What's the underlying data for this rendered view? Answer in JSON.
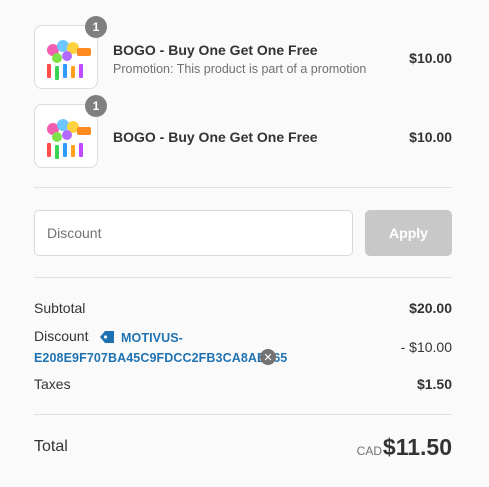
{
  "line_items": [
    {
      "quantity": "1",
      "title": "BOGO - Buy One Get One Free",
      "subtitle": "Promotion: This product is part of a promotion",
      "price": "$10.00"
    },
    {
      "quantity": "1",
      "title": "BOGO - Buy One Get One Free",
      "subtitle": "",
      "price": "$10.00"
    }
  ],
  "discount_form": {
    "placeholder": "Discount",
    "apply_label": "Apply"
  },
  "summary": {
    "subtotal_label": "Subtotal",
    "subtotal_value": "$20.00",
    "discount_label": "Discount",
    "discount_code": "MOTIVUS-E208E9F707BA45C9FDCC2FB3CA8AB165",
    "discount_value": "- $10.00",
    "taxes_label": "Taxes",
    "taxes_value": "$1.50",
    "total_label": "Total",
    "currency": "CAD",
    "total_value": "$11.50"
  },
  "colors": {
    "accent": "#1f72b1",
    "badge": "#7f7f7f",
    "button_disabled": "#c8c8c8"
  },
  "icons": {
    "tag": "tag-icon",
    "remove": "close-icon"
  }
}
